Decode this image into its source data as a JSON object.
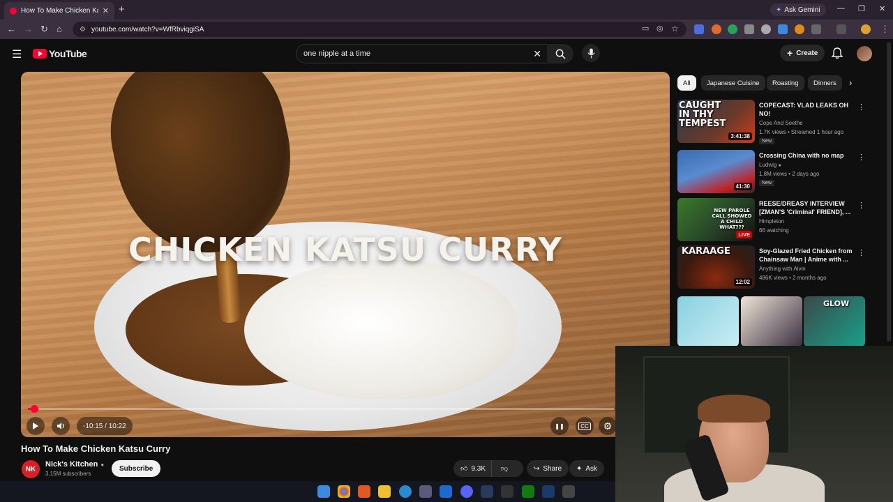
{
  "browser": {
    "tab_title": "How To Make Chicken Katsu Cu",
    "url": "youtube.com/watch?v=WfRbviqgiSA",
    "ask_gemini": "Ask Gemini"
  },
  "youtube": {
    "logo_text": "YouTube",
    "search_value": "one nipple at a time",
    "create_label": "Create"
  },
  "video": {
    "overlay_title": "CHICKEN KATSU CURRY",
    "time_display": "-10:15 / 10:22",
    "progress_fraction": 0.011,
    "title": "How To Make Chicken Katsu Curry",
    "channel_initials": "NK",
    "channel_name": "Nick's Kitchen",
    "subscribers": "3.15M subscribers",
    "subscribe_label": "Subscribe",
    "likes": "9.3K",
    "share_label": "Share",
    "ask_label": "Ask"
  },
  "sidebar": {
    "chips": [
      "All",
      "Japanese Cuisine",
      "Roasting",
      "Dinners"
    ],
    "recommendations": [
      {
        "title": "COPECAST: VLAD LEAKS OH NO!",
        "channel": "Cope And Seethe",
        "meta": "1.7K views • Streamed 1 hour ago",
        "badge": "New",
        "duration": "3:41:38",
        "thumb_text": "CAUGHT IN THY TEMPEST"
      },
      {
        "title": "Crossing China with no map",
        "channel": "Ludwig",
        "meta": "1.8M views • 2 days ago",
        "badge": "New",
        "duration": "41:30",
        "thumb_text": ""
      },
      {
        "title": "REESE/DREASY INTERVIEW [ZMAN'S 'Criminal' FRIEND], ...",
        "channel": "Himpleton",
        "meta": "66 watching",
        "badge": "",
        "duration": "LIVE",
        "thumb_text": "NEW PAROLE CALL SHOWED A CHILD WHAT???"
      },
      {
        "title": "Soy-Glazed Fried Chicken from Chainsaw Man | Anime with ...",
        "channel": "Anything with Alvin",
        "meta": "486K views • 2 months ago",
        "badge": "",
        "duration": "12:02",
        "thumb_text": "KARAAGE"
      }
    ],
    "shorts_thumb_text": "GLOW"
  },
  "colors": {
    "brand_red": "#ff0033",
    "bg": "#0f0f0f"
  }
}
